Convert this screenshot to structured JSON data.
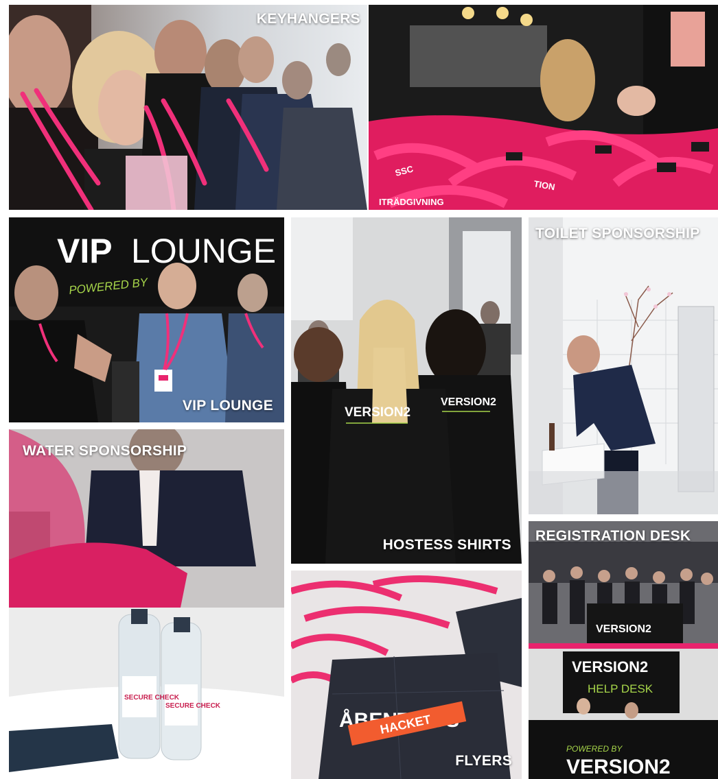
{
  "captions": {
    "keyhangers": "KEYHANGERS",
    "vip_lounge": "VIP LOUNGE",
    "toilet_sponsorship": "TOILET SPONSORSHIP",
    "water_sponsorship": "WATER SPONSORSHIP",
    "hostess_shirts": "HOSTESS SHIRTS",
    "registration_desk": "REGISTRATION DESK",
    "flyers": "FLYERS"
  },
  "scene_text": {
    "vip_sign_bold": "VIP",
    "vip_sign_light": "LOUNGE",
    "vip_powered": "POWERED BY",
    "shirt_left": "VERSION2",
    "shirt_right": "VERSION2",
    "desk_brand": "VERSION2",
    "help_desk_brand": "VERSION2",
    "help_desk_label": "HELP DESK",
    "desk_powered": "POWERED BY",
    "desk_bottom_brand": "VERSION2",
    "flyer_title": "ÅBENT HUS",
    "flyer_ribbon": "HACKET",
    "bottle_label": "SECURE CHECK"
  },
  "colors": {
    "brand_pink": "#e8246d",
    "lanyard_pink": "#f0307a",
    "dark": "#151515",
    "caption": "#ffffff"
  }
}
